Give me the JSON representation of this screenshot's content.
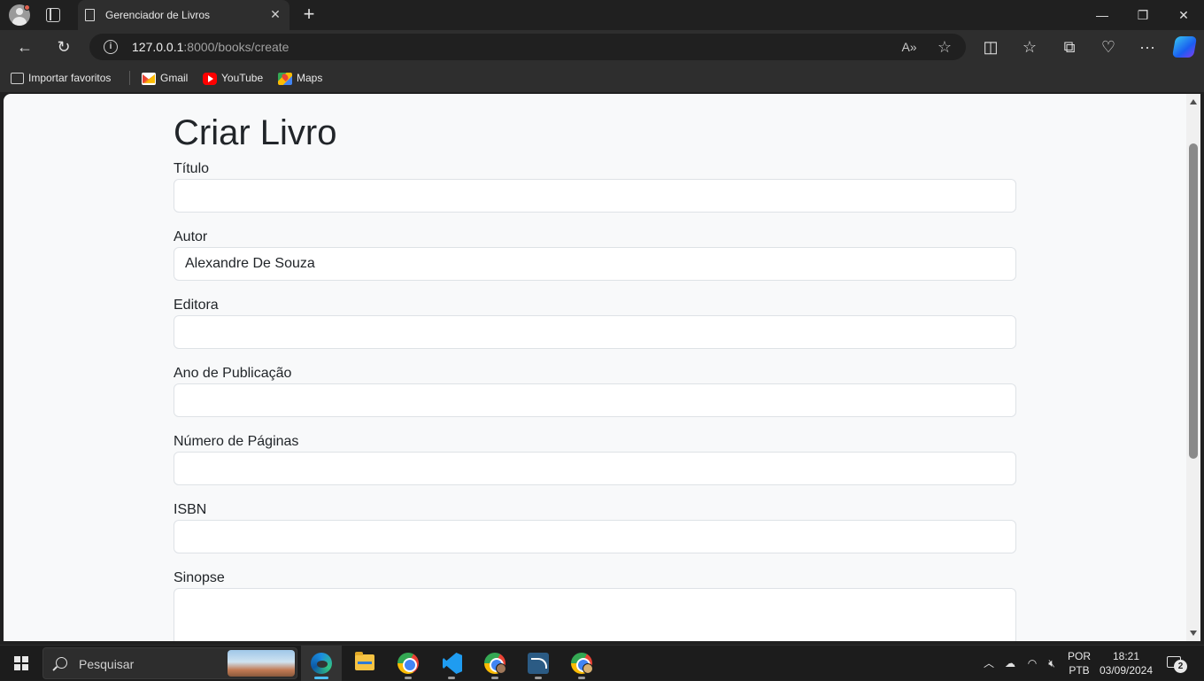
{
  "browser": {
    "tab_title": "Gerenciador de Livros",
    "tab_close": "✕",
    "new_tab": "+",
    "url_host": "127.0.0.1",
    "url_rest": ":8000/books/create",
    "window_controls": {
      "minimize": "—",
      "restore": "❐",
      "close": "✕"
    },
    "read_aloud_icon": "A»",
    "more_icon": "···"
  },
  "bookmarks": [
    {
      "label": "Importar favoritos",
      "icon": "import-icon"
    },
    {
      "label": "Gmail",
      "icon": "gmail-icon"
    },
    {
      "label": "YouTube",
      "icon": "youtube-icon"
    },
    {
      "label": "Maps",
      "icon": "maps-icon"
    }
  ],
  "page": {
    "title": "Criar Livro",
    "fields": [
      {
        "label": "Título",
        "value": ""
      },
      {
        "label": "Autor",
        "value": "Alexandre De Souza"
      },
      {
        "label": "Editora",
        "value": ""
      },
      {
        "label": "Ano de Publicação",
        "value": ""
      },
      {
        "label": "Número de Páginas",
        "value": ""
      },
      {
        "label": "ISBN",
        "value": ""
      },
      {
        "label": "Sinopse",
        "value": ""
      }
    ]
  },
  "taskbar": {
    "search_placeholder": "Pesquisar",
    "language_top": "POR",
    "language_bottom": "PTB",
    "time": "18:21",
    "date": "03/09/2024",
    "notification_count": "2",
    "apps": [
      "edge-icon",
      "file-explorer-icon",
      "chrome-icon",
      "vscode-icon",
      "chrome-profile-icon",
      "mysql-workbench-icon",
      "chrome-profile-icon"
    ]
  },
  "colors": {
    "accent": "#4cc2ff",
    "page_bg": "#f8f9fa",
    "input_border": "#dee2e6",
    "browser_chrome": "#2e2e2e"
  }
}
